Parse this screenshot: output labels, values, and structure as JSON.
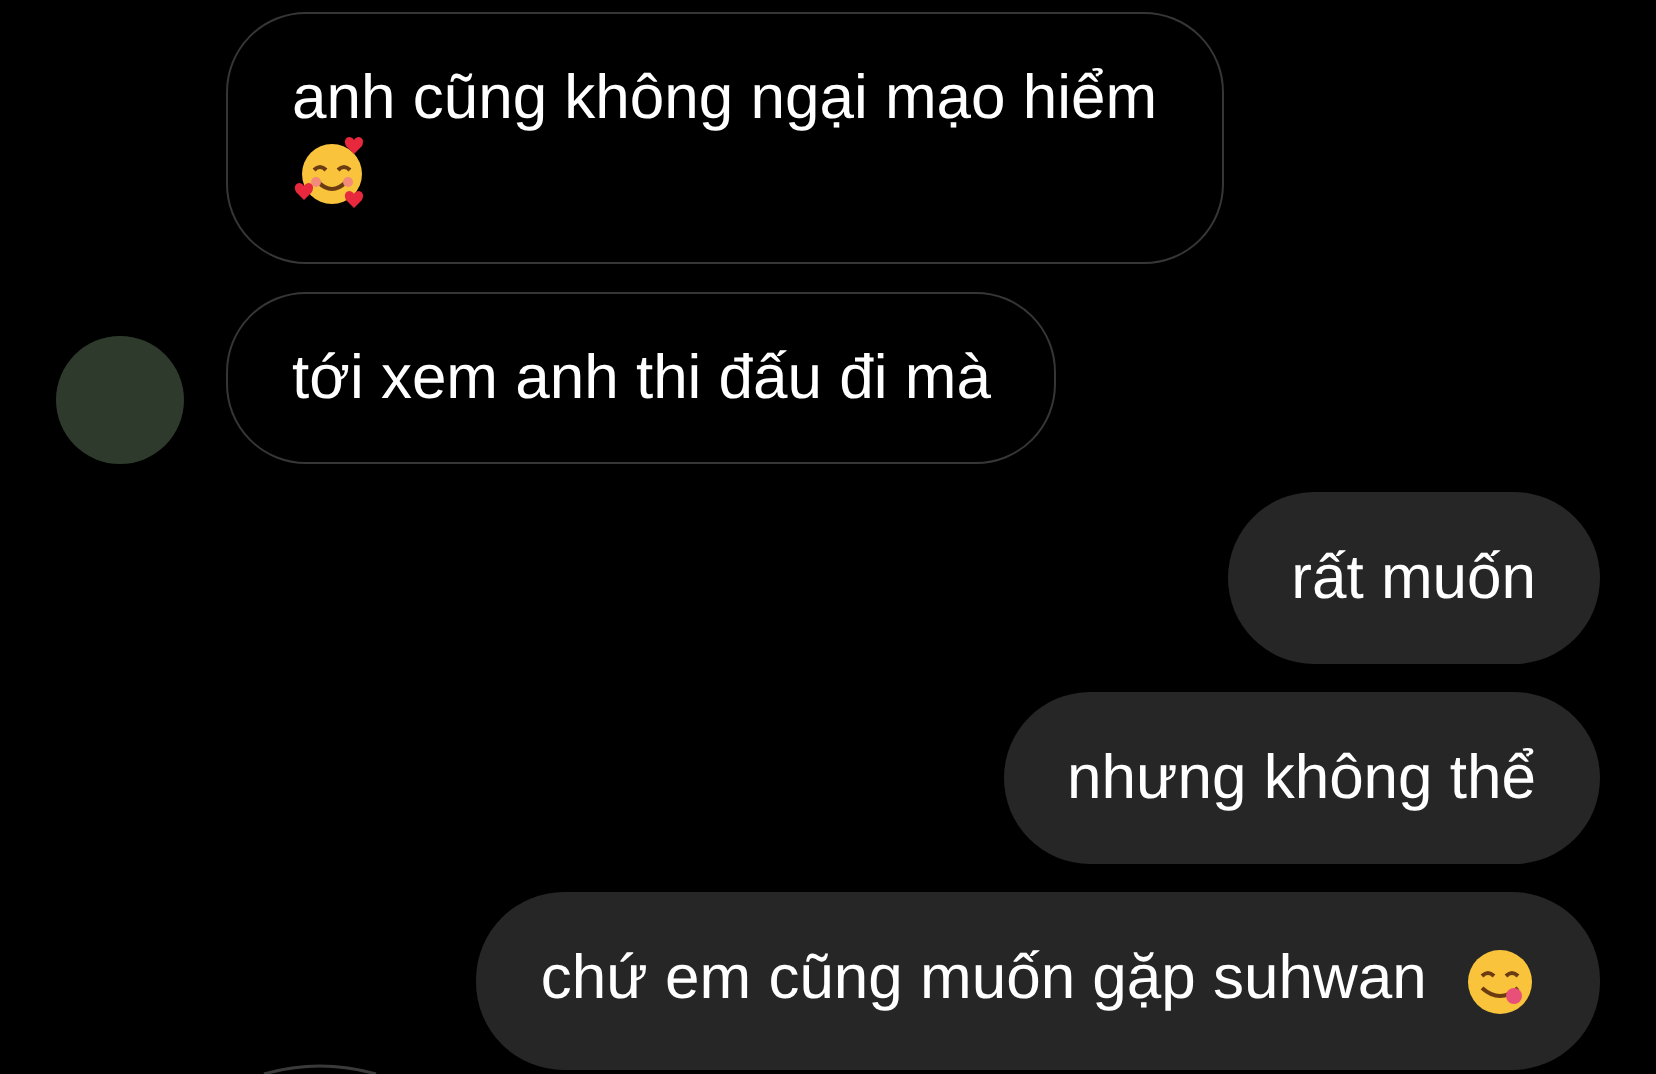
{
  "messages": [
    {
      "kind": "incoming",
      "avatar": false,
      "parts": [
        {
          "kind": "text",
          "text": "anh cũng không ngại mạo hiểm"
        },
        {
          "kind": "smiling-hearts-emoji"
        }
      ]
    },
    {
      "kind": "incoming",
      "avatar": true,
      "parts": [
        {
          "kind": "text",
          "text": "tới xem anh thi đấu đi mà"
        }
      ]
    },
    {
      "kind": "outgoing",
      "parts": [
        {
          "kind": "text",
          "text": "rất muốn"
        }
      ]
    },
    {
      "kind": "outgoing",
      "parts": [
        {
          "kind": "text",
          "text": "nhưng không thể"
        }
      ]
    },
    {
      "kind": "outgoing",
      "parts": [
        {
          "kind": "text",
          "text": "chứ em cũng muốn gặp suhwan"
        },
        {
          "kind": "yum-emoji"
        }
      ]
    }
  ]
}
